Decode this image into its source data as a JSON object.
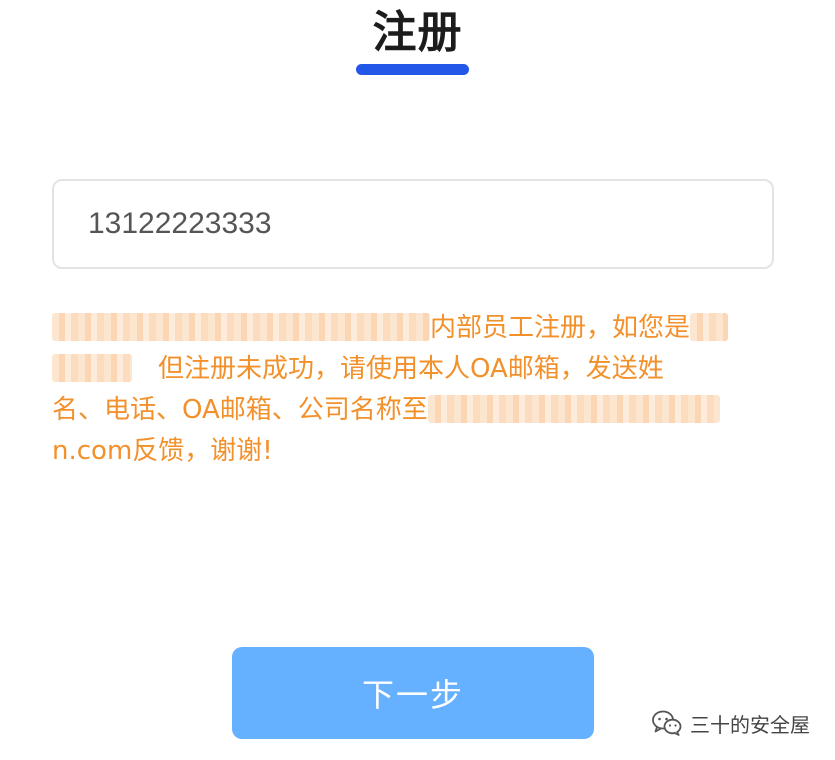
{
  "header": {
    "title": "注册"
  },
  "form": {
    "phone_value": "13122223333"
  },
  "notice": {
    "line1": "内部员工注册，如您是",
    "line2": "但注册未成功，请使用本人OA邮箱，发送姓",
    "line3": "名、电话、OA邮箱、公司名称至",
    "line4": "n.com反馈，谢谢!",
    "color": "#f2912c"
  },
  "actions": {
    "next_label": "下一步"
  },
  "watermark": {
    "text": "三十的安全屋",
    "icon": "wechat-icon"
  },
  "colors": {
    "accent": "#2357e8",
    "button": "#66b1ff"
  }
}
